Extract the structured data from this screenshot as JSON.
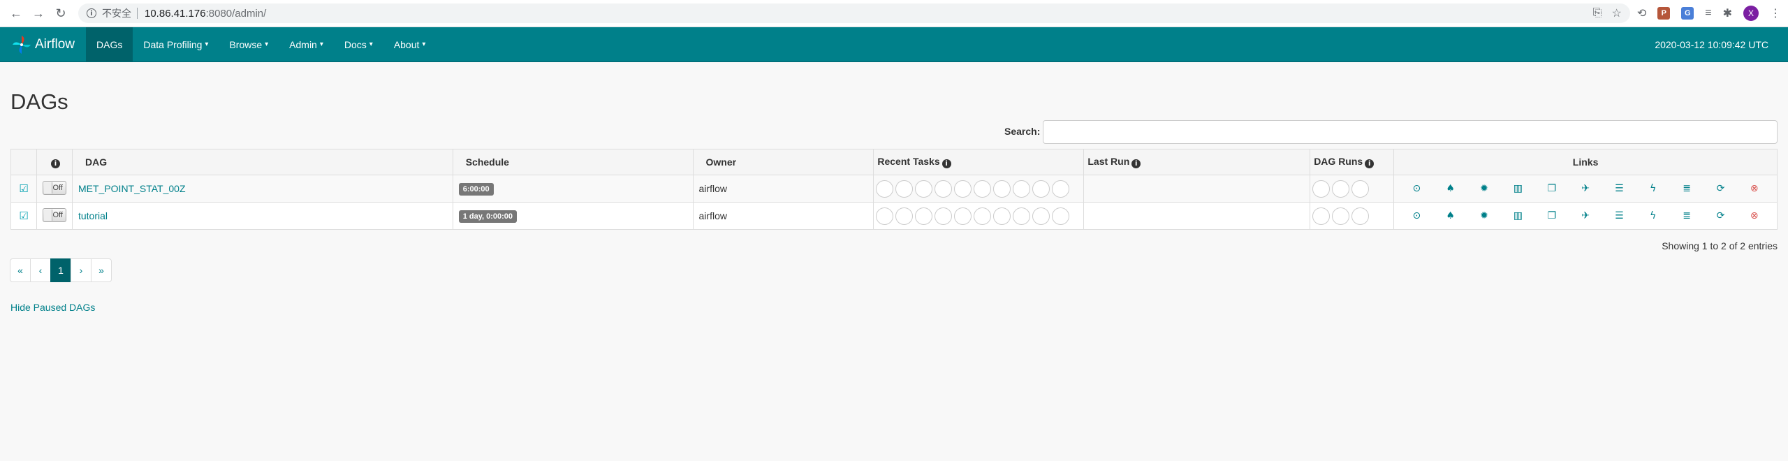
{
  "browser": {
    "back_glyph": "←",
    "forward_glyph": "→",
    "reload_glyph": "↻",
    "security_label": "不安全",
    "url_host": "10.86.41.176",
    "url_rest": ":8080/admin/",
    "avatar_letter": "X"
  },
  "navbar": {
    "brand": "Airflow",
    "items": [
      {
        "label": "DAGs",
        "active": true
      },
      {
        "label": "Data Profiling"
      },
      {
        "label": "Browse"
      },
      {
        "label": "Admin"
      },
      {
        "label": "Docs"
      },
      {
        "label": "About"
      }
    ],
    "time": "2020-03-12 10:09:42 UTC"
  },
  "page": {
    "title": "DAGs",
    "search_label": "Search:"
  },
  "table": {
    "headers": {
      "info": "i",
      "dag": "DAG",
      "schedule": "Schedule",
      "owner": "Owner",
      "recent_tasks": "Recent Tasks",
      "last_run": "Last Run",
      "dag_runs": "DAG Runs",
      "links": "Links"
    },
    "rows": [
      {
        "toggle": "Off",
        "dag": "MET_POINT_STAT_00Z",
        "schedule": "6:00:00",
        "owner": "airflow",
        "last_run": ""
      },
      {
        "toggle": "Off",
        "dag": "tutorial",
        "schedule": "1 day, 0:00:00",
        "owner": "airflow",
        "last_run": ""
      }
    ]
  },
  "footer": {
    "showing": "Showing 1 to 2 of 2 entries",
    "pagination": [
      "«",
      "‹",
      "1",
      "›",
      "»"
    ],
    "hide_paused": "Hide Paused DAGs"
  },
  "colors": {
    "navbar": "#00808a",
    "link": "#00808a",
    "danger": "#d9534f"
  }
}
